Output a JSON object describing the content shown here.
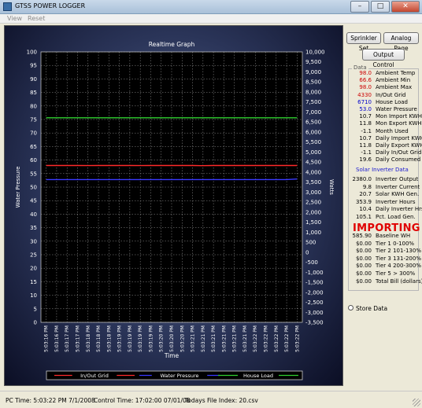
{
  "window": {
    "title": "GTSS POWER LOGGER"
  },
  "menu": {
    "items": [
      "View",
      "Reset"
    ]
  },
  "buttons": {
    "sprinkler": "Sprinkler Set",
    "analog": "Analog Page",
    "output_control": "Output Control"
  },
  "group_label": "Data",
  "readings": [
    {
      "value": "98.0",
      "label": "Ambient Temp",
      "color": "#cc0000"
    },
    {
      "value": "66.6",
      "label": "Ambient Min",
      "color": "#cc0000"
    },
    {
      "value": "98.0",
      "label": "Ambient Max",
      "color": "#cc0000"
    },
    {
      "value": "4330",
      "label": "In/Out Grid",
      "color": "#cc0000"
    },
    {
      "value": "6710",
      "label": "House Load",
      "color": "#0000cc"
    },
    {
      "value": "53.0",
      "label": "Water Pressure",
      "color": "#0000cc"
    },
    {
      "value": "10.7",
      "label": "Mon Import KWH",
      "color": "#000000"
    },
    {
      "value": "11.8",
      "label": "Mon Export KWH",
      "color": "#000000"
    },
    {
      "value": "-1.1",
      "label": "Month Used",
      "color": "#000000"
    },
    {
      "value": "10.7",
      "label": "Daily Import KWH",
      "color": "#000000"
    },
    {
      "value": "11.8",
      "label": "Daily Export KWH",
      "color": "#000000"
    },
    {
      "value": "-1.1",
      "label": "Daily In/Out Grid",
      "color": "#000000"
    },
    {
      "value": "19.6",
      "label": "Daily Consumed",
      "color": "#000000"
    }
  ],
  "solar_header": "Solar Inverter Data",
  "solar": [
    {
      "value": "2380.0",
      "label": "Inverter Output"
    },
    {
      "value": "9.8",
      "label": "Inverter Current"
    },
    {
      "value": "20.7",
      "label": "Solar KWH Gen."
    },
    {
      "value": "353.9",
      "label": "Inverter Hours"
    },
    {
      "value": "10.4",
      "label": "Daily Inverter Hrs"
    },
    {
      "value": "105.1",
      "label": "Pct. Load Gen."
    }
  ],
  "status_word": "IMPORTING",
  "bill": [
    {
      "value": "585.90",
      "label": "Baseline WH"
    },
    {
      "value": "$0.00",
      "label": "Tier 1 0-100%"
    },
    {
      "value": "$0.00",
      "label": "Tier 2 101-130%"
    },
    {
      "value": "$0.00",
      "label": "Tier 3 131-200%"
    },
    {
      "value": "$0.00",
      "label": "Tier 4 200-300%"
    },
    {
      "value": "$0.00",
      "label": "Tier 5 > 300%"
    },
    {
      "value": "$0.00",
      "label": "Total Bill (dollars)"
    }
  ],
  "store_data_label": "Store Data",
  "status": {
    "pc_time": "PC Time: 5:03:22 PM   7/1/2008",
    "control_time": "Control Time: 17:02:00  07/01/08",
    "file_index": "Todays File Index: 20.csv"
  },
  "chart_data": {
    "type": "line",
    "title": "Realtime Graph",
    "xlabel": "Time",
    "ylabel": "Water Pressure",
    "y2label": "Watts",
    "ylim": [
      0,
      100
    ],
    "y2lim": [
      -3500,
      10000
    ],
    "yticks": [
      0,
      5,
      10,
      15,
      20,
      25,
      30,
      35,
      40,
      45,
      50,
      55,
      60,
      65,
      70,
      75,
      80,
      85,
      90,
      95,
      100
    ],
    "y2ticks": [
      "-3,500",
      "-3,000",
      "-2,500",
      "-2,000",
      "-1,500",
      "-1,000",
      "-500",
      "0",
      "500",
      "1,000",
      "1,500",
      "2,000",
      "2,500",
      "3,000",
      "3,500",
      "4,000",
      "4,500",
      "5,000",
      "5,500",
      "6,000",
      "6,500",
      "7,000",
      "7,500",
      "8,000",
      "8,500",
      "9,000",
      "9,500",
      "10,000"
    ],
    "categories": [
      "5:03:16 PM",
      "5:03:16 PM",
      "5:03:17 PM",
      "5:03:17 PM",
      "5:03:18 PM",
      "5:03:18 PM",
      "5:03:18 PM",
      "5:03:19 PM",
      "5:03:19 PM",
      "5:03:19 PM",
      "5:03:19 PM",
      "5:03:20 PM",
      "5:03:20 PM",
      "5:03:20 PM",
      "5:03:21 PM",
      "5:03:21 PM",
      "5:03:21 PM",
      "5:03:21 PM",
      "5:03:21 PM",
      "5:03:21 PM",
      "5:03:22 PM",
      "5:03:22 PM",
      "5:03:22 PM",
      "5:03:22 PM",
      "5:03:22 PM"
    ],
    "grid": true,
    "legend_position": "bottom",
    "series": [
      {
        "name": "In/Out Grid",
        "axis": "y2",
        "color": "#ff2a2a",
        "values": [
          4330,
          4330,
          4330,
          4330,
          4325,
          4330,
          4330,
          4330,
          4330,
          4325,
          4330,
          4330,
          4330,
          4330,
          4330,
          4320,
          4330,
          4330,
          4330,
          4330,
          4330,
          4330,
          4330,
          4330,
          4330
        ]
      },
      {
        "name": "Water Pressure",
        "axis": "y",
        "color": "#3a3aff",
        "values": [
          52.8,
          52.8,
          52.8,
          52.8,
          52.8,
          52.8,
          52.8,
          52.8,
          52.8,
          52.8,
          52.8,
          52.8,
          52.8,
          52.8,
          52.8,
          52.8,
          52.8,
          52.8,
          52.8,
          52.8,
          52.8,
          52.8,
          52.8,
          52.8,
          53.0
        ]
      },
      {
        "name": "House Load",
        "axis": "y2",
        "color": "#2fd02f",
        "values": [
          6710,
          6710,
          6710,
          6710,
          6710,
          6710,
          6710,
          6710,
          6710,
          6710,
          6710,
          6710,
          6710,
          6710,
          6710,
          6710,
          6710,
          6710,
          6710,
          6710,
          6710,
          6710,
          6710,
          6710,
          6710
        ]
      }
    ]
  }
}
